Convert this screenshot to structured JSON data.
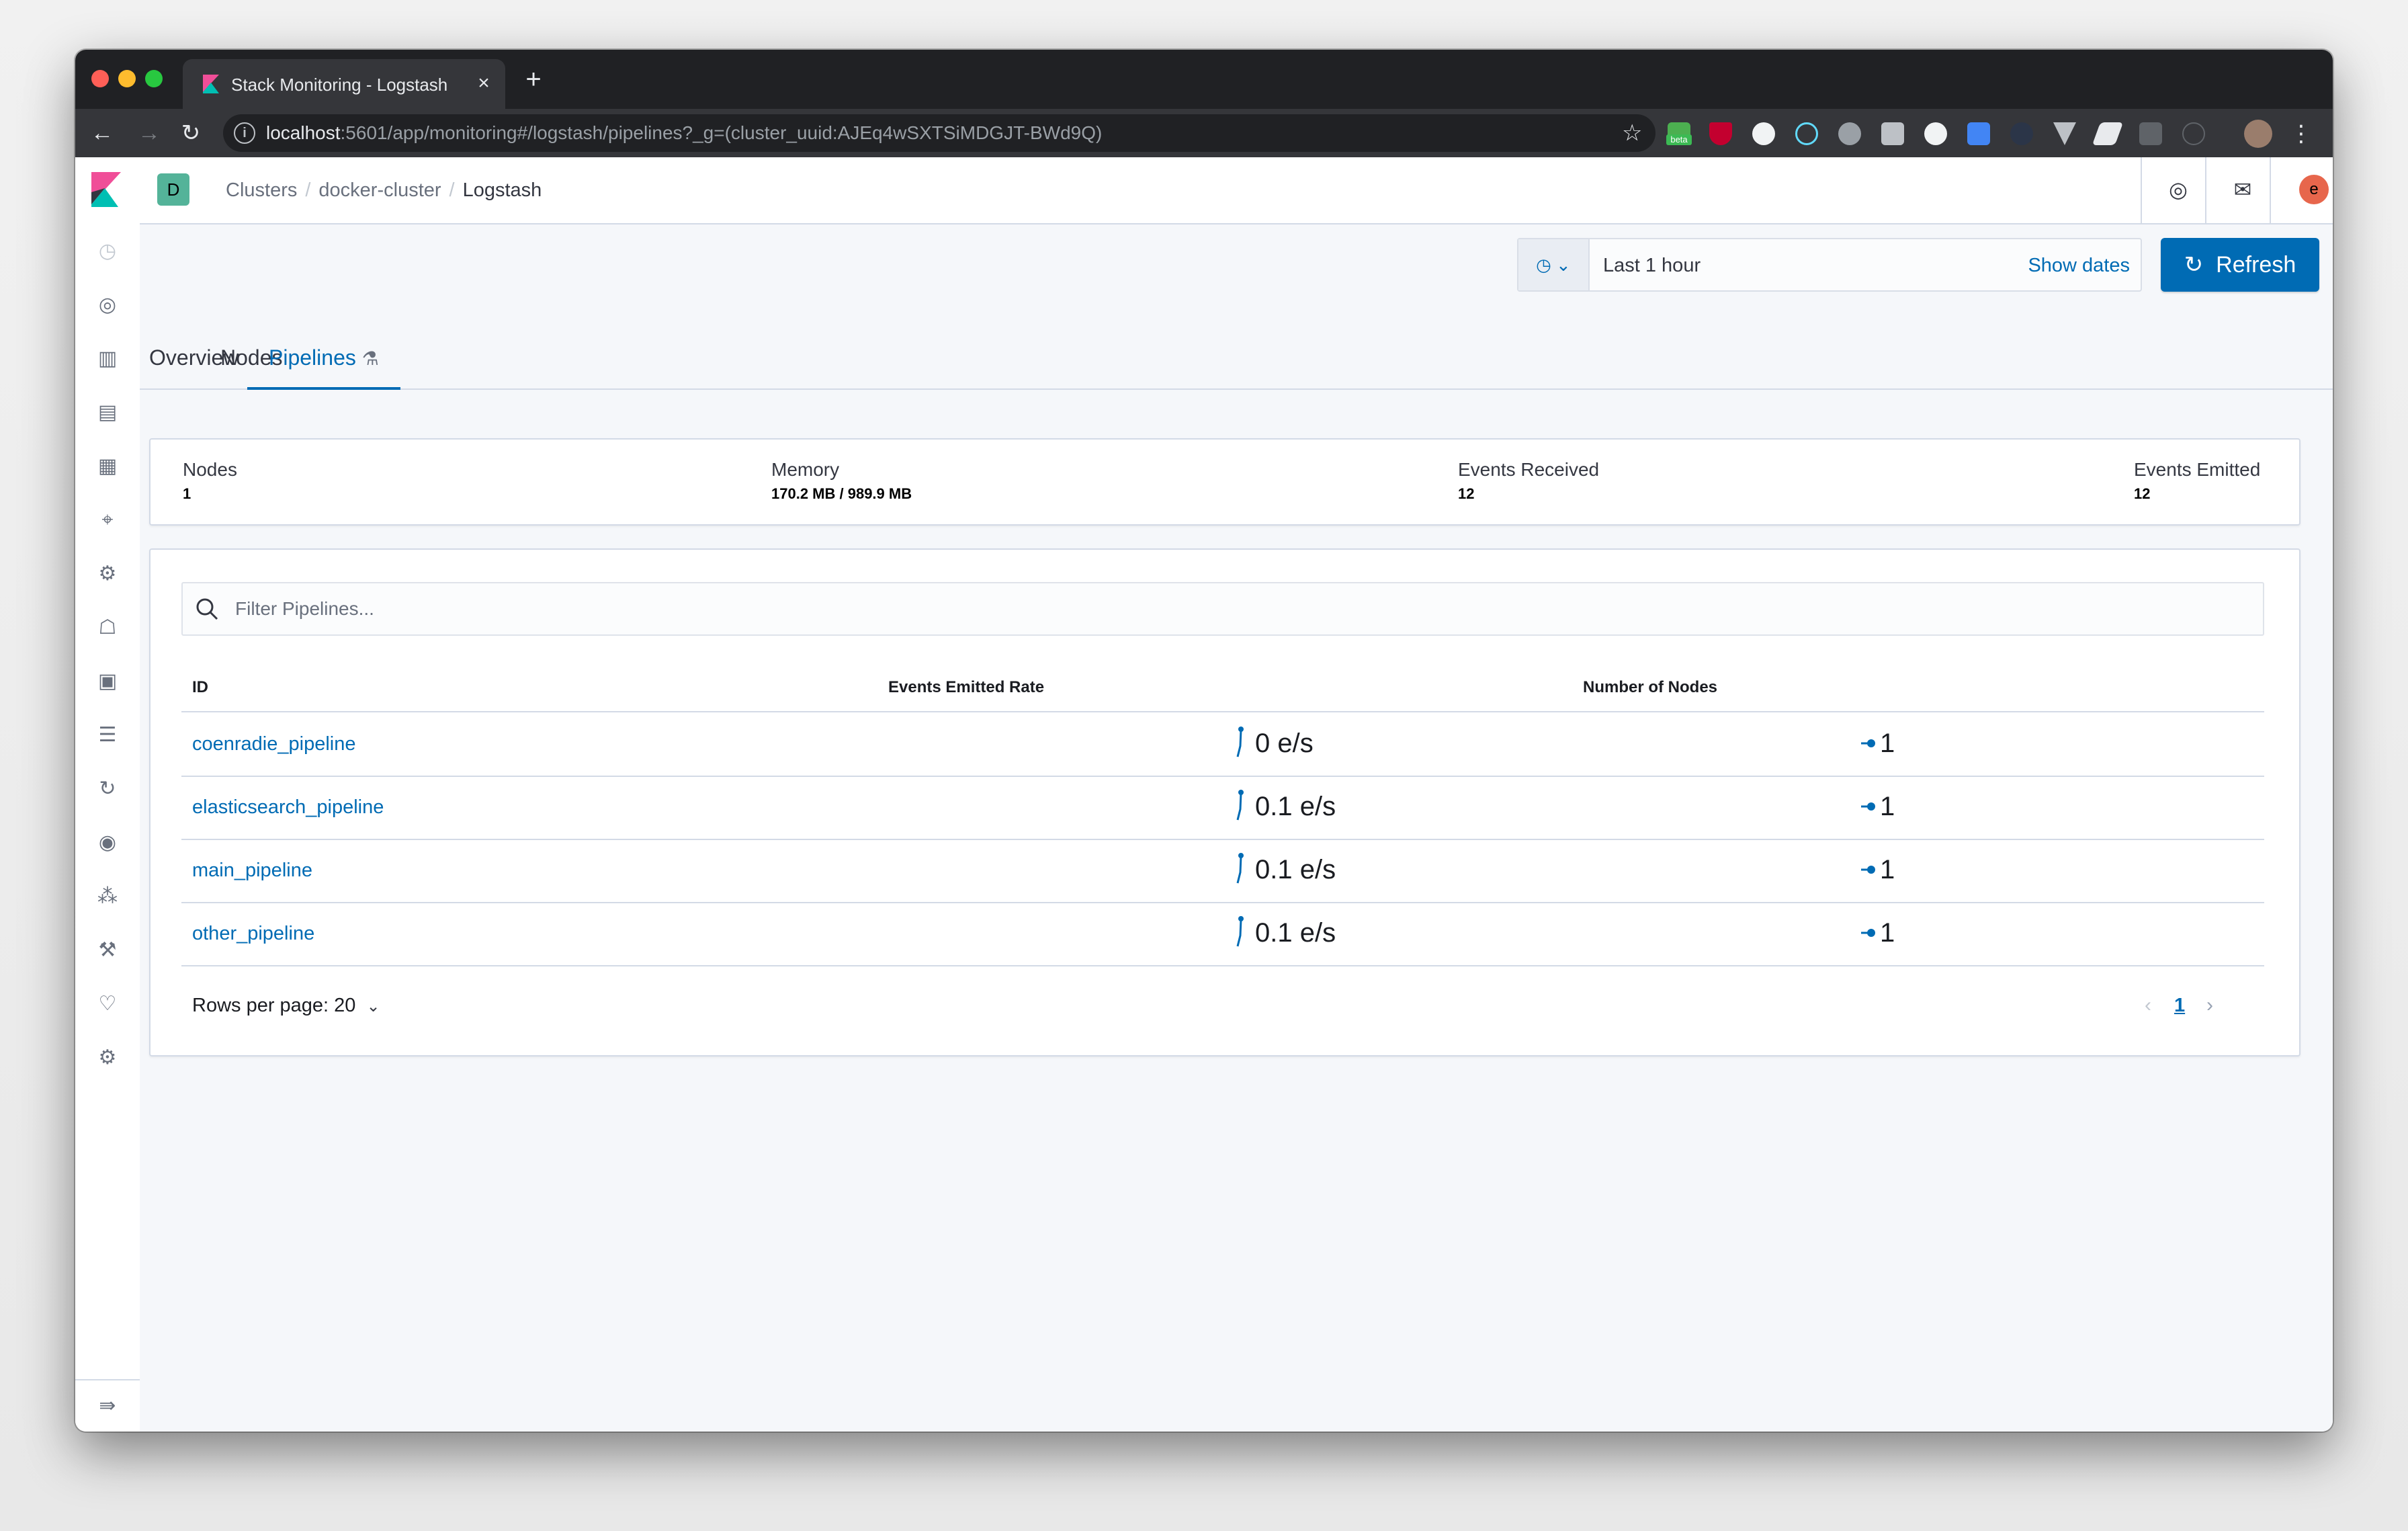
{
  "browser": {
    "tab_title": "Stack Monitoring - Logstash Pipe",
    "tab_close": "×",
    "new_tab": "+",
    "url_host": "localhost",
    "url_rest": ":5601/app/monitoring#/logstash/pipelines?_g=(cluster_uuid:AJEq4wSXTSiMDGJT-BWd9Q)",
    "extension_badge": "beta",
    "icons": {
      "back": "←",
      "forward": "→",
      "reload": "↻",
      "info": "i",
      "star": "☆",
      "menu": "⋮"
    }
  },
  "header": {
    "space_initial": "D",
    "breadcrumbs": [
      "Clusters",
      "docker-cluster",
      "Logstash"
    ],
    "user_initial": "e",
    "help_icon": "◎",
    "mail_icon": "✉"
  },
  "sidebar": {
    "items": [
      {
        "name": "recently-viewed",
        "glyph": "◷"
      },
      {
        "name": "discover",
        "glyph": "◎"
      },
      {
        "name": "visualize",
        "glyph": "▥"
      },
      {
        "name": "dashboard",
        "glyph": "▤"
      },
      {
        "name": "canvas",
        "glyph": "▦"
      },
      {
        "name": "maps",
        "glyph": "⌖"
      },
      {
        "name": "machine-learning",
        "glyph": "⚙"
      },
      {
        "name": "infrastructure",
        "glyph": "☖"
      },
      {
        "name": "logs",
        "glyph": "▣"
      },
      {
        "name": "apm",
        "glyph": "☰"
      },
      {
        "name": "uptime",
        "glyph": "↻"
      },
      {
        "name": "siem",
        "glyph": "◉"
      },
      {
        "name": "graph",
        "glyph": "⁂"
      },
      {
        "name": "dev-tools",
        "glyph": "⚒"
      },
      {
        "name": "stack-monitoring",
        "glyph": "♡"
      },
      {
        "name": "management",
        "glyph": "⚙"
      }
    ],
    "dock_glyph": "⇛"
  },
  "toolbar": {
    "time_range": "Last 1 hour",
    "show_dates": "Show dates",
    "refresh_label": "Refresh",
    "refresh_glyph": "↻",
    "quick_select_glyph": "◷ ⌄"
  },
  "tabs": [
    {
      "label": "Overview",
      "active": false
    },
    {
      "label": "Nodes",
      "active": false
    },
    {
      "label": "Pipelines",
      "active": true,
      "badge": "⚗"
    }
  ],
  "summary": {
    "nodes": {
      "title": "Nodes",
      "value": "1"
    },
    "memory": {
      "title": "Memory",
      "value": "170.2 MB / 989.9 MB"
    },
    "events_received": {
      "title": "Events Received",
      "value": "12"
    },
    "events_emitted": {
      "title": "Events Emitted",
      "value": "12"
    }
  },
  "table": {
    "search_placeholder": "Filter Pipelines...",
    "columns": [
      "ID",
      "Events Emitted Rate",
      "Number of Nodes"
    ],
    "rows": [
      {
        "id": "coenradie_pipeline",
        "rate": "0 e/s",
        "nodes": "1"
      },
      {
        "id": "elasticsearch_pipeline",
        "rate": "0.1 e/s",
        "nodes": "1"
      },
      {
        "id": "main_pipeline",
        "rate": "0.1 e/s",
        "nodes": "1"
      },
      {
        "id": "other_pipeline",
        "rate": "0.1 e/s",
        "nodes": "1"
      }
    ],
    "rows_per_page": "Rows per page: 20",
    "rows_per_page_chevron": "⌄",
    "page_prev": "‹",
    "page_current": "1",
    "page_next": "›"
  },
  "colors": {
    "accent": "#006bb4",
    "space_avatar": "#54b399",
    "user_avatar": "#e7664c"
  }
}
